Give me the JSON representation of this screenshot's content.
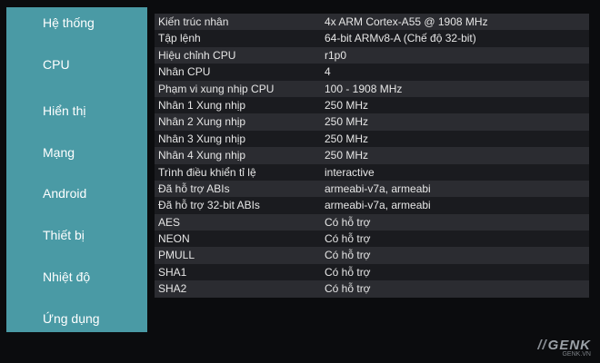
{
  "sidebar": {
    "items": [
      {
        "label": "Hệ thống"
      },
      {
        "label": "CPU"
      },
      {
        "label": "Hiển thị"
      },
      {
        "label": "Mạng"
      },
      {
        "label": "Android"
      },
      {
        "label": "Thiết bị"
      },
      {
        "label": "Nhiệt độ"
      },
      {
        "label": "Ứng dụng"
      }
    ]
  },
  "cpu_info": {
    "rows": [
      {
        "key": "Kiến trúc nhân",
        "value": "4x ARM Cortex-A55 @ 1908 MHz"
      },
      {
        "key": "Tập lệnh",
        "value": "64-bit ARMv8-A (Chế độ 32-bit)"
      },
      {
        "key": "Hiệu chỉnh CPU",
        "value": "r1p0"
      },
      {
        "key": "Nhân CPU",
        "value": "4"
      },
      {
        "key": "Phạm vi xung nhịp CPU",
        "value": "100 - 1908 MHz"
      },
      {
        "key": "Nhân 1 Xung nhịp",
        "value": "250 MHz"
      },
      {
        "key": "Nhân 2 Xung nhịp",
        "value": "250 MHz"
      },
      {
        "key": "Nhân 3 Xung nhịp",
        "value": "250 MHz"
      },
      {
        "key": "Nhân 4 Xung nhịp",
        "value": "250 MHz"
      },
      {
        "key": "Trình điều khiển tỉ lệ",
        "value": "interactive"
      },
      {
        "key": "Đã hỗ trợ ABIs",
        "value": "armeabi-v7a, armeabi"
      },
      {
        "key": "Đã hỗ trợ 32-bit ABIs",
        "value": "armeabi-v7a, armeabi"
      },
      {
        "key": "AES",
        "value": "Có hỗ trợ"
      },
      {
        "key": "NEON",
        "value": "Có hỗ trợ"
      },
      {
        "key": "PMULL",
        "value": "Có hỗ trợ"
      },
      {
        "key": "SHA1",
        "value": "Có hỗ trợ"
      },
      {
        "key": "SHA2",
        "value": "Có hỗ trợ"
      }
    ]
  },
  "watermark": {
    "logo": "GENK",
    "url": "GENK.VN"
  },
  "colors": {
    "sidebar_bg": "#4a9aa5",
    "row_odd": "#2b2c31",
    "row_even": "#1a1b1f"
  }
}
